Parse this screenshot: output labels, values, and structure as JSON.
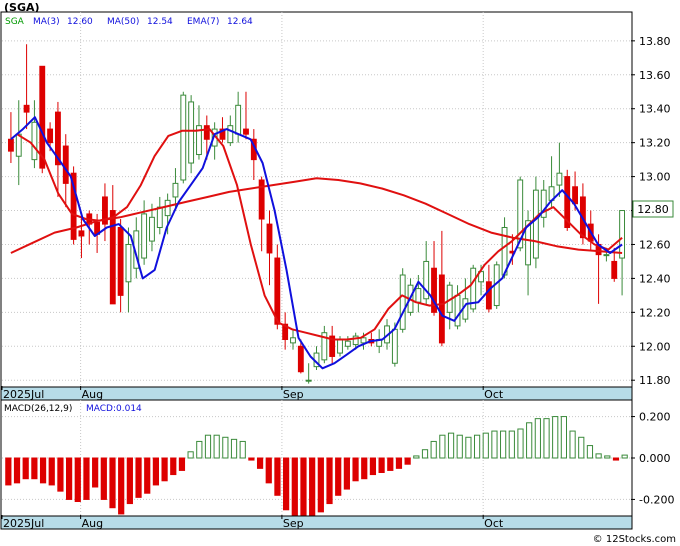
{
  "chart_data": {
    "type": "candlestick",
    "ticker_label": "(SGA)",
    "price_panel": {
      "legend": [
        {
          "label": "SGA",
          "value": "",
          "color": "#009900"
        },
        {
          "label": "MA(3)",
          "value": "12.60",
          "color": "#1010dd"
        },
        {
          "label": "MA(50)",
          "value": "12.54",
          "color": "#1010dd"
        },
        {
          "label": "EMA(7)",
          "value": "12.64",
          "color": "#1010dd"
        }
      ],
      "ylim": [
        11.76,
        13.97
      ],
      "yticks": [
        "11.80",
        "12.00",
        "12.20",
        "12.40",
        "12.60",
        "12.80",
        "13.00",
        "13.20",
        "13.40",
        "13.60",
        "13.80"
      ],
      "last_price_label": "12.80",
      "candles": [
        [
          13.22,
          13.38,
          13.08,
          13.15
        ],
        [
          13.12,
          13.45,
          12.95,
          13.25
        ],
        [
          13.42,
          13.78,
          13.28,
          13.38
        ],
        [
          13.1,
          13.45,
          13.05,
          13.32
        ],
        [
          13.65,
          13.65,
          13.02,
          13.05
        ],
        [
          13.28,
          13.32,
          13.15,
          13.2
        ],
        [
          13.38,
          13.44,
          12.88,
          13.07
        ],
        [
          13.18,
          13.25,
          12.82,
          12.96
        ],
        [
          13.02,
          13.06,
          12.6,
          12.63
        ],
        [
          12.68,
          12.78,
          12.52,
          12.65
        ],
        [
          12.78,
          12.8,
          12.6,
          12.72
        ],
        [
          12.73,
          12.78,
          12.55,
          12.66
        ],
        [
          12.88,
          12.96,
          12.62,
          12.72
        ],
        [
          12.8,
          12.95,
          12.25,
          12.25
        ],
        [
          12.7,
          12.75,
          12.2,
          12.3
        ],
        [
          12.38,
          12.7,
          12.2,
          12.6
        ],
        [
          12.46,
          12.76,
          12.4,
          12.68
        ],
        [
          12.52,
          12.86,
          12.48,
          12.78
        ],
        [
          12.62,
          12.84,
          12.56,
          12.76
        ],
        [
          12.7,
          12.88,
          12.66,
          12.82
        ],
        [
          12.77,
          12.9,
          12.66,
          12.86
        ],
        [
          12.88,
          13.05,
          12.8,
          12.96
        ],
        [
          12.98,
          13.5,
          12.96,
          13.48
        ],
        [
          13.08,
          13.48,
          13.02,
          13.44
        ],
        [
          13.13,
          13.42,
          13.1,
          13.3
        ],
        [
          13.3,
          13.36,
          13.1,
          13.22
        ],
        [
          13.18,
          13.32,
          13.1,
          13.28
        ],
        [
          13.28,
          13.35,
          13.2,
          13.22
        ],
        [
          13.2,
          13.36,
          13.18,
          13.3
        ],
        [
          13.25,
          13.5,
          13.2,
          13.42
        ],
        [
          13.28,
          13.5,
          13.22,
          13.25
        ],
        [
          13.22,
          13.28,
          12.98,
          13.1
        ],
        [
          12.98,
          13.0,
          12.56,
          12.75
        ],
        [
          12.72,
          12.8,
          12.36,
          12.55
        ],
        [
          12.52,
          12.6,
          12.1,
          12.13
        ],
        [
          12.13,
          12.2,
          11.98,
          12.04
        ],
        [
          12.02,
          12.1,
          11.98,
          12.05
        ],
        [
          12.0,
          12.04,
          11.84,
          11.85
        ],
        [
          11.8,
          11.9,
          11.78,
          11.8
        ],
        [
          11.88,
          12.0,
          11.86,
          11.96
        ],
        [
          11.92,
          12.12,
          11.9,
          12.08
        ],
        [
          12.06,
          12.12,
          11.9,
          11.94
        ],
        [
          11.96,
          12.06,
          11.94,
          12.04
        ],
        [
          12.0,
          12.06,
          11.98,
          12.03
        ],
        [
          12.01,
          12.08,
          11.98,
          12.06
        ],
        [
          12.02,
          12.08,
          11.98,
          12.05
        ],
        [
          12.04,
          12.08,
          12.0,
          12.02
        ],
        [
          12.0,
          12.1,
          11.96,
          12.04
        ],
        [
          12.02,
          12.16,
          11.98,
          12.12
        ],
        [
          11.9,
          12.14,
          11.88,
          12.1
        ],
        [
          12.1,
          12.46,
          12.08,
          12.42
        ],
        [
          12.2,
          12.4,
          12.18,
          12.36
        ],
        [
          12.26,
          12.42,
          12.2,
          12.34
        ],
        [
          12.28,
          12.62,
          12.24,
          12.5
        ],
        [
          12.46,
          12.62,
          12.18,
          12.2
        ],
        [
          12.42,
          12.68,
          12.0,
          12.02
        ],
        [
          12.2,
          12.38,
          12.1,
          12.36
        ],
        [
          12.12,
          12.36,
          12.1,
          12.3
        ],
        [
          12.16,
          12.4,
          12.14,
          12.28
        ],
        [
          12.22,
          12.48,
          12.2,
          12.46
        ],
        [
          12.38,
          12.48,
          12.3,
          12.44
        ],
        [
          12.38,
          12.48,
          12.2,
          12.22
        ],
        [
          12.24,
          12.5,
          12.22,
          12.48
        ],
        [
          12.42,
          12.76,
          12.4,
          12.7
        ],
        [
          12.56,
          12.66,
          12.48,
          12.55
        ],
        [
          12.58,
          13.0,
          12.56,
          12.98
        ],
        [
          12.48,
          12.8,
          12.3,
          12.74
        ],
        [
          12.52,
          13.0,
          12.46,
          12.92
        ],
        [
          12.76,
          12.98,
          12.7,
          12.92
        ],
        [
          12.86,
          13.12,
          12.82,
          12.94
        ],
        [
          12.95,
          13.2,
          12.88,
          13.02
        ],
        [
          13.0,
          13.04,
          12.68,
          12.7
        ],
        [
          12.94,
          13.03,
          12.8,
          12.84
        ],
        [
          12.88,
          12.96,
          12.6,
          12.64
        ],
        [
          12.72,
          12.8,
          12.56,
          12.62
        ],
        [
          12.6,
          12.66,
          12.25,
          12.54
        ],
        [
          12.54,
          12.58,
          12.5,
          12.54
        ],
        [
          12.5,
          12.58,
          12.38,
          12.4
        ],
        [
          12.52,
          12.8,
          12.3,
          12.8
        ]
      ],
      "ma3": [
        13.22,
        13.28,
        13.35,
        13.2,
        13.1,
        13.0,
        12.75,
        12.65,
        12.7,
        12.72,
        12.65,
        12.4,
        12.45,
        12.7,
        12.85,
        12.95,
        13.05,
        13.25,
        13.28,
        13.25,
        13.22,
        13.08,
        12.8,
        12.45,
        12.05,
        11.94,
        11.87,
        11.9,
        11.95,
        12.0,
        12.03,
        12.04,
        12.1,
        12.24,
        12.38,
        12.3,
        12.18,
        12.15,
        12.25,
        12.26,
        12.34,
        12.4,
        12.55,
        12.7,
        12.76,
        12.85,
        12.92,
        12.84,
        12.72,
        12.6,
        12.55,
        12.6
      ],
      "ma3_start": 0,
      "ema7": [
        13.25,
        13.2,
        13.1,
        12.9,
        12.78,
        12.75,
        12.74,
        12.76,
        12.82,
        12.95,
        13.12,
        13.24,
        13.27,
        13.27,
        13.28,
        13.18,
        12.95,
        12.6,
        12.3,
        12.14,
        12.1,
        12.08,
        12.06,
        12.04,
        12.04,
        12.05,
        12.1,
        12.22,
        12.3,
        12.26,
        12.24,
        12.25,
        12.3,
        12.36,
        12.48,
        12.56,
        12.62,
        12.7,
        12.78,
        12.82,
        12.74,
        12.66,
        12.6,
        12.57,
        12.64
      ],
      "ma50": [
        12.55,
        12.61,
        12.67,
        12.7,
        12.74,
        12.76,
        12.79,
        12.82,
        12.85,
        12.88,
        12.91,
        12.93,
        12.95,
        12.97,
        12.99,
        12.98,
        12.96,
        12.93,
        12.89,
        12.84,
        12.78,
        12.72,
        12.67,
        12.64,
        12.62,
        12.59,
        12.57,
        12.56,
        12.55
      ],
      "x_ticks": [
        "2025Jul",
        "Aug",
        "Sep",
        "Oct"
      ]
    },
    "macd_panel": {
      "label": "MACD(26,12,9)",
      "value_label": "MACD:0.014",
      "ylim": [
        -0.28,
        0.28
      ],
      "yticks": [
        "-0.200",
        "0.000",
        "0.200"
      ],
      "histogram": [
        -0.13,
        -0.12,
        -0.1,
        -0.1,
        -0.12,
        -0.13,
        -0.16,
        -0.2,
        -0.21,
        -0.2,
        -0.14,
        -0.2,
        -0.24,
        -0.27,
        -0.22,
        -0.19,
        -0.17,
        -0.13,
        -0.11,
        -0.08,
        -0.06,
        0.03,
        0.08,
        0.11,
        0.11,
        0.1,
        0.09,
        0.08,
        -0.01,
        -0.05,
        -0.12,
        -0.18,
        -0.25,
        -0.28,
        -0.3,
        -0.31,
        -0.26,
        -0.22,
        -0.18,
        -0.15,
        -0.11,
        -0.1,
        -0.08,
        -0.07,
        -0.06,
        -0.05,
        -0.03,
        0.01,
        0.04,
        0.08,
        0.11,
        0.12,
        0.11,
        0.1,
        0.11,
        0.12,
        0.13,
        0.13,
        0.13,
        0.14,
        0.17,
        0.19,
        0.19,
        0.2,
        0.2,
        0.13,
        0.1,
        0.06,
        0.02,
        0.01,
        -0.01,
        0.014
      ],
      "x_ticks": [
        "2025Jul",
        "Aug",
        "Sep",
        "Oct"
      ]
    },
    "watermark": "© 12Stocks.com",
    "colors": {
      "up": "#3a8a3a",
      "down": "#dd0000",
      "ma_blue": "#1010dd",
      "ma_red": "#e01010",
      "axis_band": "#b7dce8"
    }
  }
}
